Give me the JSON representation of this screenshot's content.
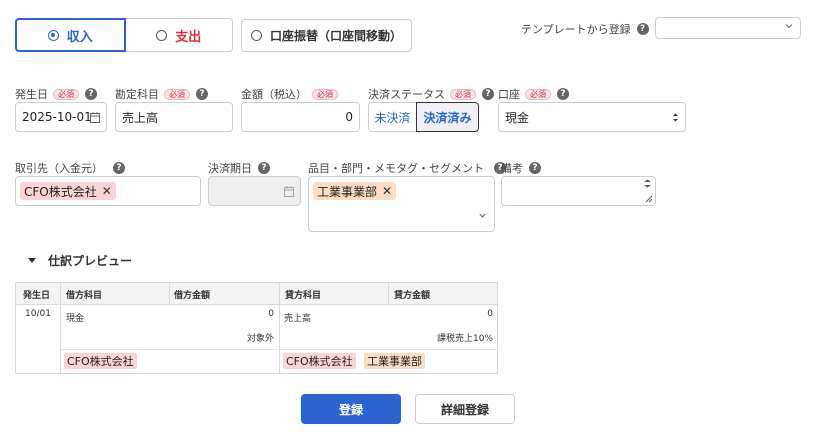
{
  "type_toggle": {
    "income_label": "収入",
    "expense_label": "支出",
    "selected": "income"
  },
  "transfer_label": "口座振替（口座間移動）",
  "template": {
    "label": "テンプレートから登録",
    "value": ""
  },
  "required_badge": "必須",
  "help_glyph": "?",
  "fields": {
    "date": {
      "label": "発生日",
      "value": "2025-10-01"
    },
    "account": {
      "label": "勘定科目",
      "value": "売上高"
    },
    "amount": {
      "label": "金額（税込）",
      "value": "0"
    },
    "status": {
      "label": "決済ステータス",
      "pending_label": "未決済",
      "done_label": "決済済み",
      "selected": "done"
    },
    "wallet": {
      "label": "口座",
      "value": "現金"
    },
    "partner": {
      "label": "取引先（入金元）",
      "tag": "CFO株式会社"
    },
    "due_date": {
      "label": "決済期日",
      "value": ""
    },
    "segments": {
      "label": "品目・部門・メモタグ・セグメント",
      "tag": "工業事業部"
    },
    "memo": {
      "label": "備考",
      "value": ""
    }
  },
  "preview": {
    "title": "仕訳プレビュー",
    "headers": {
      "date": "発生日",
      "debit_account": "借方科目",
      "debit_amount": "借方金額",
      "credit_account": "貸方科目",
      "credit_amount": "貸方金額"
    },
    "row": {
      "date": "10/01",
      "debit_account": "現金",
      "debit_amount": "0",
      "debit_tax": "対象外",
      "debit_tag": "CFO株式会社",
      "credit_account": "売上高",
      "credit_amount": "0",
      "credit_tax": "課税売上10%",
      "credit_tag1": "CFO株式会社",
      "credit_tag2": "工業事業部"
    }
  },
  "actions": {
    "submit_label": "登録",
    "detail_label": "詳細登録"
  },
  "colors": {
    "primary": "#2b64d1",
    "expense": "#d8333a",
    "tag_pink": "#f9d3d8",
    "tag_orange": "#fcdcc4"
  }
}
